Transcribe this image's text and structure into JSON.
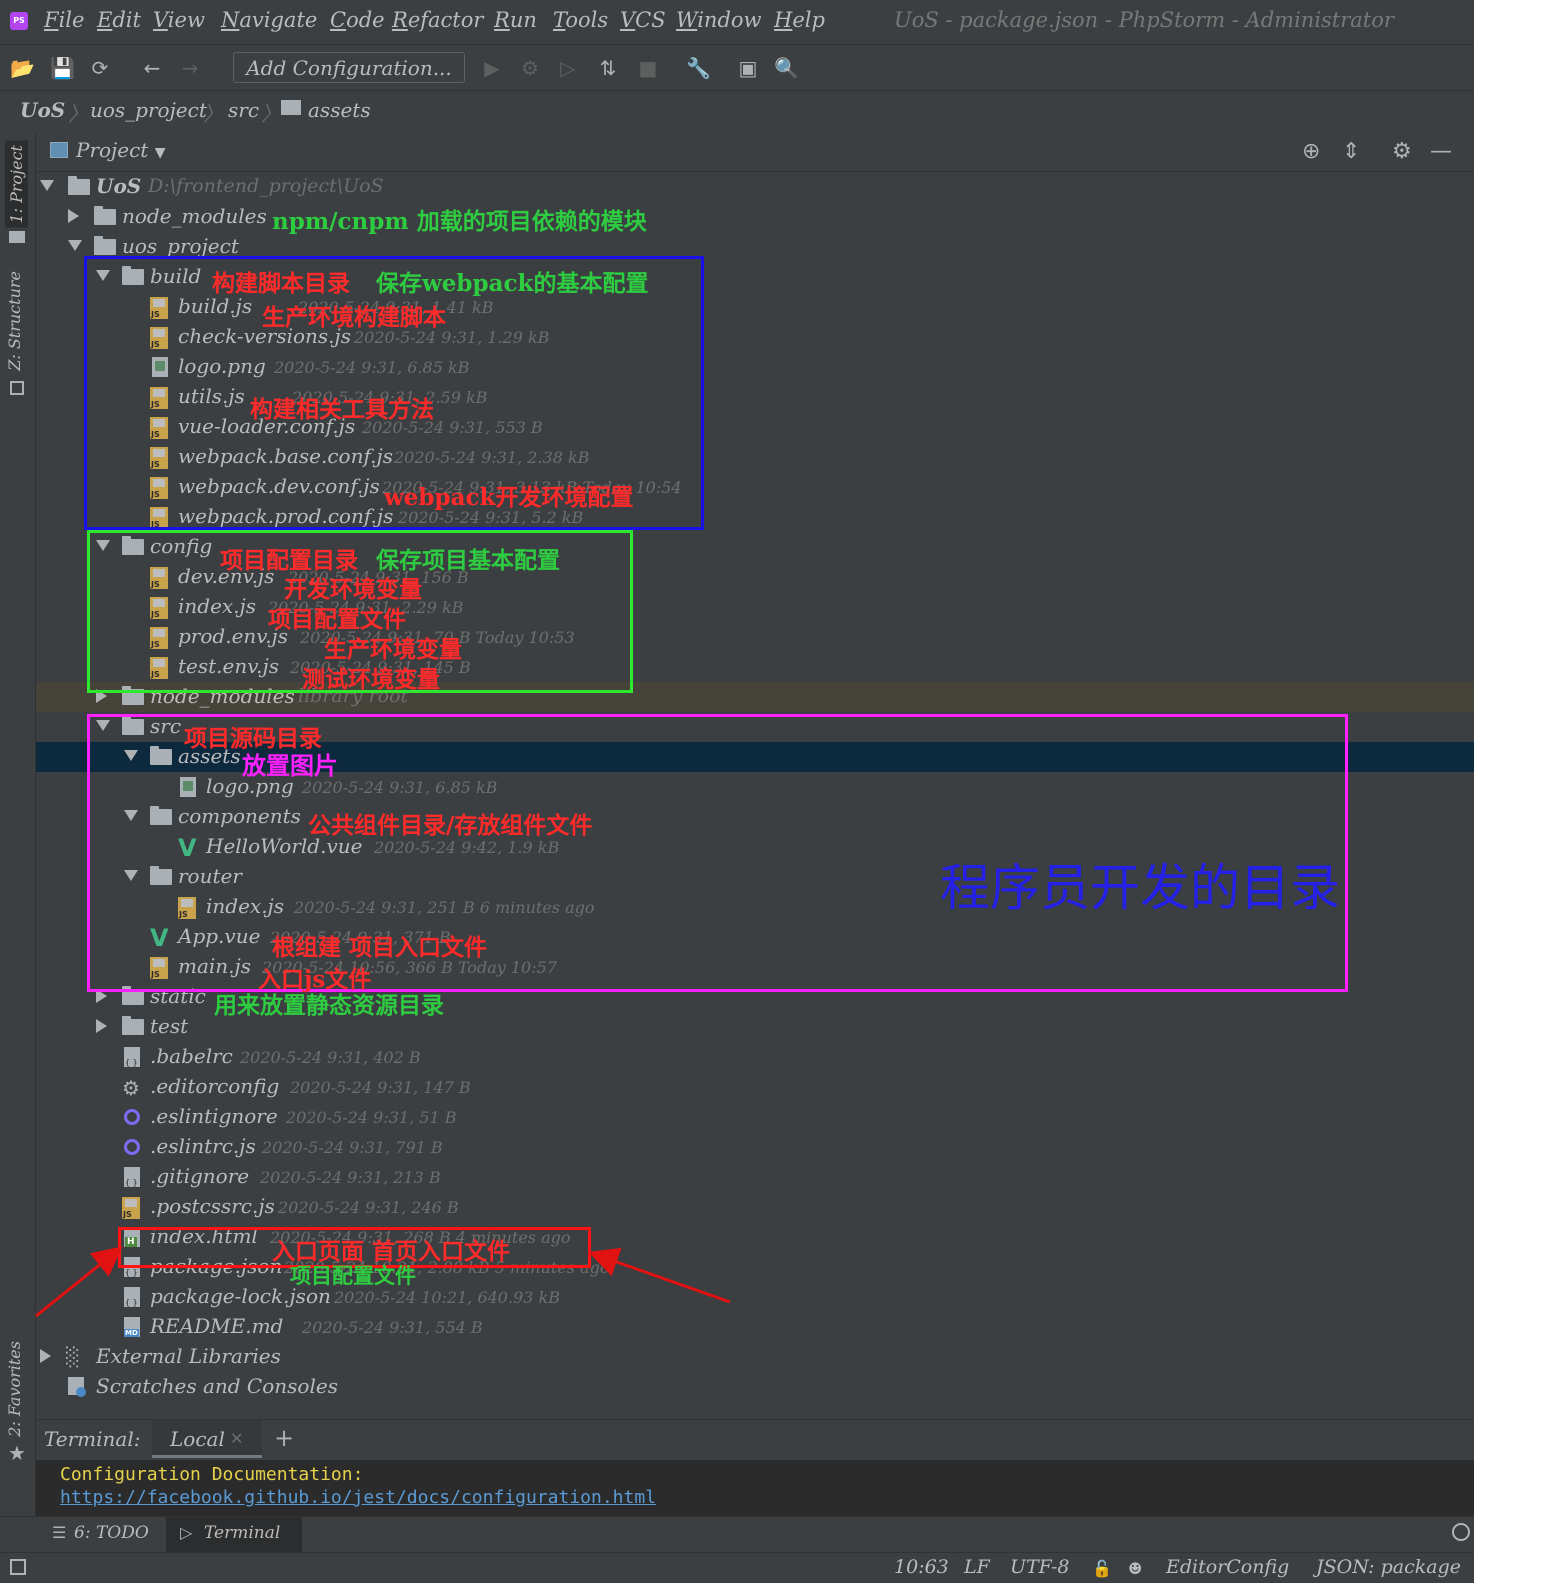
{
  "window": {
    "title": "UoS - package.json - PhpStorm - Administrator",
    "app_logo_text": "PS",
    "menu": [
      "File",
      "Edit",
      "View",
      "Navigate",
      "Code",
      "Refactor",
      "Run",
      "Tools",
      "VCS",
      "Window",
      "Help"
    ],
    "menu_mnemonics": [
      "F",
      "E",
      "V",
      "N",
      "C",
      "R",
      "R",
      "T",
      "V",
      "W",
      "H"
    ]
  },
  "toolbar": {
    "icons": [
      "open-folder-icon",
      "save-icon",
      "sync-icon",
      "back-arrow-icon",
      "forward-arrow-icon",
      "run-icon",
      "debug-icon",
      "coverage-icon",
      "profile-icon",
      "stop-icon",
      "settings-wrench-icon",
      "terminal-window-icon",
      "search-icon"
    ],
    "add_configuration": "Add Configuration..."
  },
  "breadcrumb": {
    "items": [
      "UoS",
      "uos_project",
      "src",
      "assets"
    ]
  },
  "left_tabs": {
    "project": "1: Project",
    "structure": "Z: Structure",
    "favorites": "2: Favorites"
  },
  "project_panel": {
    "title": "Project"
  },
  "tree": {
    "root_name": "UoS",
    "root_path": "D:\\frontend_project\\UoS",
    "rows": [
      {
        "name": "node_modules",
        "meta": ""
      },
      {
        "name": "uos_project",
        "meta": ""
      },
      {
        "name": "build",
        "meta": ""
      },
      {
        "name": "build.js",
        "meta": "2020-5-24 9:31, 1.41 kB"
      },
      {
        "name": "check-versions.js",
        "meta": "2020-5-24 9:31, 1.29 kB"
      },
      {
        "name": "logo.png",
        "meta": "2020-5-24 9:31, 6.85 kB"
      },
      {
        "name": "utils.js",
        "meta": "2020-5-24 9:31, 2.59 kB"
      },
      {
        "name": "vue-loader.conf.js",
        "meta": "2020-5-24 9:31, 553 B"
      },
      {
        "name": "webpack.base.conf.js",
        "meta": "2020-5-24 9:31, 2.38 kB"
      },
      {
        "name": "webpack.dev.conf.js",
        "meta": "2020-5-24 9:31, 3.13 kB Today 10:54"
      },
      {
        "name": "webpack.prod.conf.js",
        "meta": "2020-5-24 9:31, 5.2 kB"
      },
      {
        "name": "config",
        "meta": ""
      },
      {
        "name": "dev.env.js",
        "meta": "2020-5-24 9:31, 156 B"
      },
      {
        "name": "index.js",
        "meta": "2020-5-24 9:31, 2.29 kB"
      },
      {
        "name": "prod.env.js",
        "meta": "2020-5-24 9:31, 70 B Today 10:53"
      },
      {
        "name": "test.env.js",
        "meta": "2020-5-24 9:31, 145 B"
      },
      {
        "name": "node_modules",
        "meta": "library root"
      },
      {
        "name": "src",
        "meta": ""
      },
      {
        "name": "assets",
        "meta": ""
      },
      {
        "name": "logo.png",
        "meta": "2020-5-24 9:31, 6.85 kB"
      },
      {
        "name": "components",
        "meta": ""
      },
      {
        "name": "HelloWorld.vue",
        "meta": "2020-5-24 9:42, 1.9 kB"
      },
      {
        "name": "router",
        "meta": ""
      },
      {
        "name": "index.js",
        "meta": "2020-5-24 9:31, 251 B 6 minutes ago"
      },
      {
        "name": "App.vue",
        "meta": "2020-5-24 9:31, 371 B"
      },
      {
        "name": "main.js",
        "meta": "2020-5-24 10:56, 366 B Today 10:57"
      },
      {
        "name": "static",
        "meta": ""
      },
      {
        "name": "test",
        "meta": ""
      },
      {
        "name": ".babelrc",
        "meta": "2020-5-24 9:31, 402 B"
      },
      {
        "name": ".editorconfig",
        "meta": "2020-5-24 9:31, 147 B"
      },
      {
        "name": ".eslintignore",
        "meta": "2020-5-24 9:31, 51 B"
      },
      {
        "name": ".eslintrc.js",
        "meta": "2020-5-24 9:31, 791 B"
      },
      {
        "name": ".gitignore",
        "meta": "2020-5-24 9:31, 213 B"
      },
      {
        "name": ".postcssrc.js",
        "meta": "2020-5-24 9:31, 246 B"
      },
      {
        "name": "index.html",
        "meta": "2020-5-24 9:31, 268 B 4 minutes ago"
      },
      {
        "name": "package.json",
        "meta": "2020-5-24 10:21, 2.88 kB 5 minutes ago"
      },
      {
        "name": "package-lock.json",
        "meta": "2020-5-24 10:21, 640.93 kB"
      },
      {
        "name": "README.md",
        "meta": "2020-5-24 9:31, 554 B"
      },
      {
        "name": "External Libraries",
        "meta": ""
      },
      {
        "name": "Scratches and Consoles",
        "meta": ""
      }
    ]
  },
  "annotations": {
    "node_modules_label": "npm/cnpm 加载的项目依赖的模块",
    "build_dir": "构建脚本目录",
    "build_desc": "保存webpack的基本配置",
    "build_js": "生产环境构建脚本",
    "utils_js": "构建相关工具方法",
    "webpack_dev": "webpack开发环境配置",
    "config_dir": "项目配置目录",
    "config_desc": "保存项目基本配置",
    "dev_env": "开发环境变量",
    "index_js": "项目配置文件",
    "prod_env": "生产环境变量",
    "test_env": "测试环境变量",
    "src_dir": "项目源码目录",
    "assets_dir": "放置图片",
    "components_dir": "公共组件目录/存放组件文件",
    "dev_dir_big": "程序员开发的目录",
    "app_vue": "根组建 项目入口文件",
    "main_js": "入口js文件",
    "static_dir": "用来放置静态资源目录",
    "index_html": "入口页面 首页入口文件",
    "package_json": "项目配置文件"
  },
  "terminal": {
    "label": "Terminal:",
    "tab": "Local",
    "line1": "Configuration Documentation:",
    "line2": "https://facebook.github.io/jest/docs/configuration.html"
  },
  "bottom_tabs": {
    "todo": "6: TODO",
    "terminal": "Terminal"
  },
  "status": {
    "position": "10:63",
    "line_sep": "LF",
    "encoding": "UTF-8",
    "editorconfig": "EditorConfig",
    "schema": "JSON: package"
  },
  "colors": {
    "ide_bg": "#3c3f41",
    "selected_row": "#0d293e",
    "box_blue": "#1a10e8",
    "box_green": "#2ee82e",
    "box_magenta": "#ff20ff",
    "box_red": "#ff1414",
    "terminal_yellow": "#e6d14a",
    "terminal_link": "#5a9bd6"
  }
}
